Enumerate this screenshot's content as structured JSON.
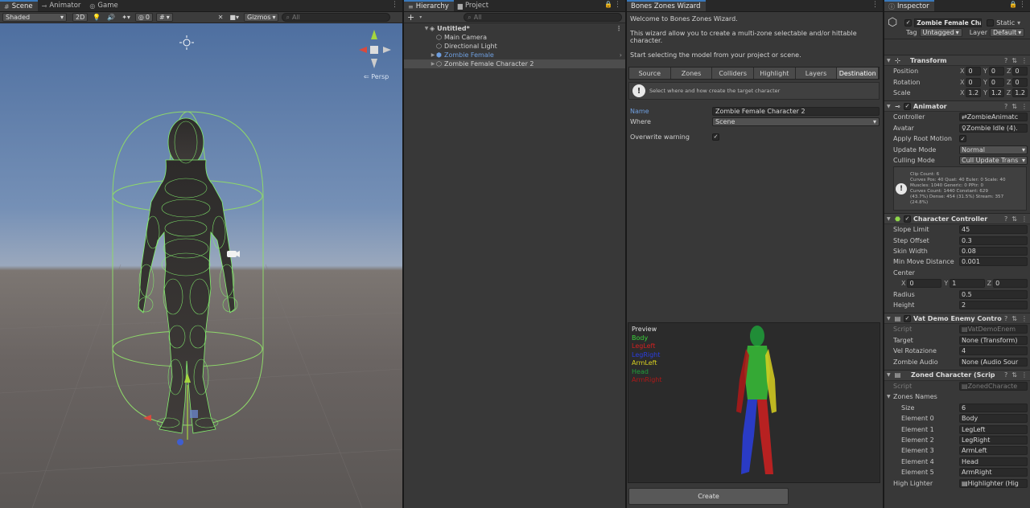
{
  "scene": {
    "tabs": [
      {
        "label": "Scene",
        "icon": "#"
      },
      {
        "label": "Animator",
        "icon": "⊸"
      },
      {
        "label": "Game",
        "icon": "◎"
      }
    ],
    "shading": "Shaded",
    "mode_2d": "2D",
    "hidden_count": "0",
    "gizmos": "Gizmos",
    "search_placeholder": "All",
    "persp": "Persp"
  },
  "hierarchy": {
    "tab_hierarchy": "Hierarchy",
    "tab_project": "Project",
    "add_button": "+",
    "search_placeholder": "All",
    "items": [
      {
        "label": "Untitled*"
      },
      {
        "label": "Main Camera"
      },
      {
        "label": "Directional Light"
      },
      {
        "label": "Zombie Female"
      },
      {
        "label": "Zombie Female Character 2"
      }
    ]
  },
  "wizard": {
    "tab_title": "Bones Zones Wizard",
    "welcome": "Welcome to Bones Zones Wizard.",
    "desc": "This wizard allow you to create a multi-zone selectable and/or hittable character.",
    "start": "Start selecting the model from your project or scene.",
    "tabs": [
      "Source",
      "Zones",
      "Colliders",
      "Highlight",
      "Layers",
      "Destination"
    ],
    "active_tab": "Destination",
    "help_text": "Select where and how create the target character",
    "name_label": "Name",
    "name_value": "Zombie Female Character 2",
    "where_label": "Where",
    "where_value": "Scene",
    "overwrite_label": "Overwrite warning",
    "preview": {
      "title": "Preview",
      "legend": [
        {
          "label": "Body",
          "color": "#3ad43a"
        },
        {
          "label": "LegLeft",
          "color": "#d02020"
        },
        {
          "label": "LegRight",
          "color": "#2a3ee0"
        },
        {
          "label": "ArmLeft",
          "color": "#d8d020"
        },
        {
          "label": "Head",
          "color": "#1f9f3a"
        },
        {
          "label": "ArmRight",
          "color": "#b01818"
        }
      ]
    },
    "create_button": "Create"
  },
  "inspector": {
    "tab_title": "Inspector",
    "object_name": "Zombie Female Charac",
    "static_label": "Static",
    "tag_label": "Tag",
    "tag_value": "Untagged",
    "layer_label": "Layer",
    "layer_value": "Default",
    "transform": {
      "title": "Transform",
      "position_label": "Position",
      "position": [
        "0",
        "0",
        "0"
      ],
      "rotation_label": "Rotation",
      "rotation": [
        "0",
        "0",
        "0"
      ],
      "scale_label": "Scale",
      "scale": [
        "1.2",
        "1.2",
        "1.2"
      ]
    },
    "animator": {
      "title": "Animator",
      "controller_label": "Controller",
      "controller": "ZombieAnimatc",
      "avatar_label": "Avatar",
      "avatar": "Zombie Idle (4).",
      "root_motion_label": "Apply Root Motion",
      "update_mode_label": "Update Mode",
      "update_mode": "Normal",
      "culling_label": "Culling Mode",
      "culling": "Cull Update Trans",
      "stats": "Clip Count: 6\nCurves Pos: 40 Quat: 40 Euler: 0 Scale: 40\nMuscles: 1040 Generic: 0 PPtr: 0\nCurves Count: 1440 Constant: 629\n(43.7%) Dense: 454 (31.5%) Stream: 357\n(24.8%)"
    },
    "character_controller": {
      "title": "Character Controller",
      "slope_label": "Slope Limit",
      "slope": "45",
      "step_label": "Step Offset",
      "step": "0.3",
      "skin_label": "Skin Width",
      "skin": "0.08",
      "minmove_label": "Min Move Distance",
      "minmove": "0.001",
      "center_label": "Center",
      "center": [
        "0",
        "1",
        "0"
      ],
      "radius_label": "Radius",
      "radius": "0.5",
      "height_label": "Height",
      "height": "2"
    },
    "vat": {
      "title": "Vat Demo Enemy Contro",
      "script_label": "Script",
      "script": "VatDemoEnem",
      "target_label": "Target",
      "target": "None (Transform)",
      "vel_label": "Vel Rotazione",
      "vel": "4",
      "audio_label": "Zombie Audio",
      "audio": "None (Audio Sour"
    },
    "zoned": {
      "title": "Zoned Character (Scrip",
      "script_label": "Script",
      "script": "ZonedCharacte",
      "zones_label": "Zones Names",
      "size_label": "Size",
      "size": "6",
      "elements": [
        {
          "label": "Element 0",
          "value": "Body"
        },
        {
          "label": "Element 1",
          "value": "LegLeft"
        },
        {
          "label": "Element 2",
          "value": "LegRight"
        },
        {
          "label": "Element 3",
          "value": "ArmLeft"
        },
        {
          "label": "Element 4",
          "value": "Head"
        },
        {
          "label": "Element 5",
          "value": "ArmRight"
        }
      ],
      "highlighter_label": "High Lighter",
      "highlighter": "Highlighter (Hig"
    }
  }
}
